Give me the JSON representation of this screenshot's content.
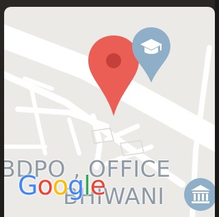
{
  "map": {
    "place_label_line1": "BDPO , OFFICE",
    "place_label_line2": "BHIWANI",
    "attribution_logo": "Google",
    "logo_colors": [
      "#4285F4",
      "#EA4335",
      "#FBBC05",
      "#4285F4",
      "#34A853",
      "#EA4335"
    ],
    "selected_pin_color": "#EA5E55",
    "poi_pin_color": "#8FAFC9",
    "selected_pin_icon": "location-pin-icon",
    "poi_education_icon": "graduation-cap-icon",
    "poi_government_icon": "government-building-icon"
  }
}
